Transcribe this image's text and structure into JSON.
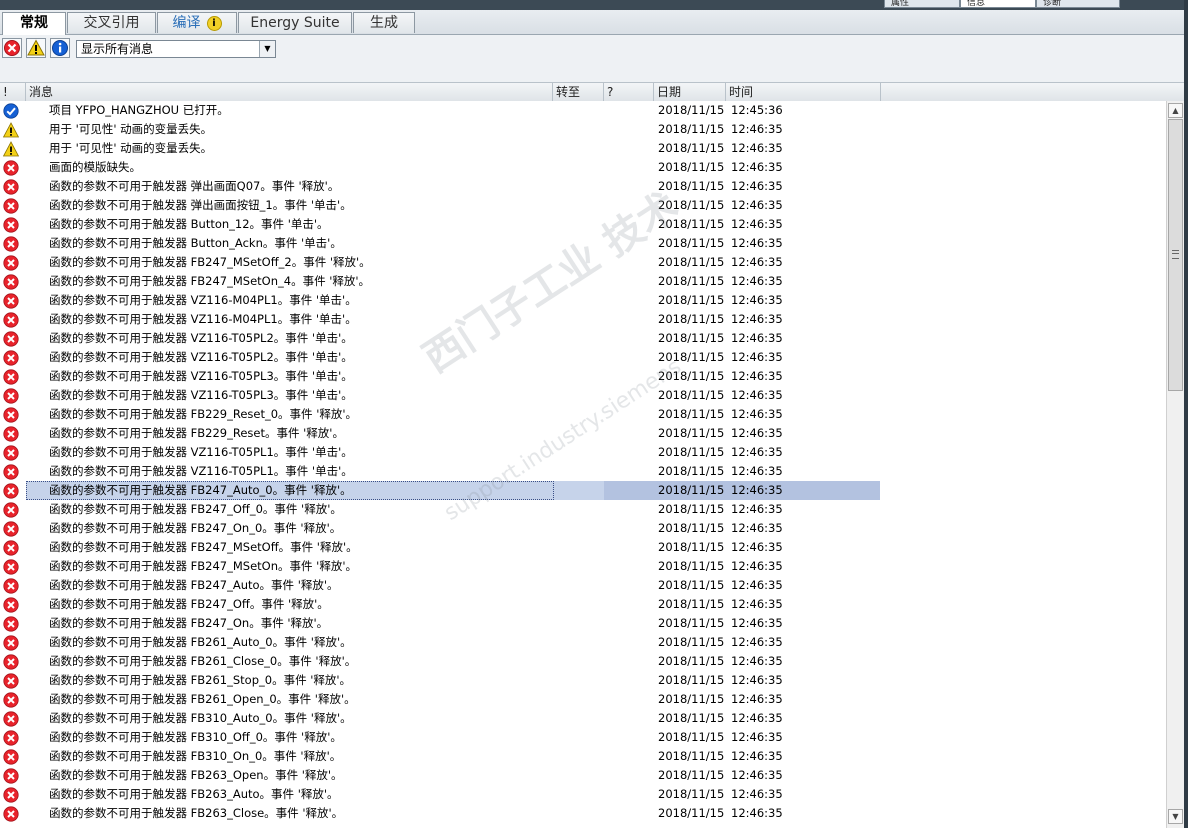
{
  "top_tabs": [
    {
      "label": "属性"
    },
    {
      "label": "信息"
    },
    {
      "label": "诊断"
    }
  ],
  "tabs": [
    {
      "label": "常规",
      "active": true
    },
    {
      "label": "交叉引用"
    },
    {
      "label": "编译",
      "info_badge": "i"
    },
    {
      "label": "Energy Suite"
    },
    {
      "label": "生成"
    }
  ],
  "toolbar": {
    "filter_value": "显示所有消息",
    "error_filter_icon": "error-filter-icon",
    "warning_filter_icon": "warning-filter-icon",
    "info_filter_icon": "info-filter-icon"
  },
  "columns": {
    "severity": "!",
    "message": "消息",
    "goto": "转至",
    "help": "?",
    "date": "日期",
    "time": "时间"
  },
  "colors": {
    "error": "#e8232b",
    "warning": "#f3d117",
    "ok": "#1560d4",
    "selected_row": "#c6d3ea"
  },
  "watermark": {
    "line1": "西门子工业 技术",
    "line2": "support.industry.siemens"
  },
  "rows": [
    {
      "type": "ok",
      "message": "项目 YFPO_HANGZHOU 已打开。",
      "date": "2018/11/15",
      "time": "12:45:36"
    },
    {
      "type": "warning",
      "message": "用于 '可见性' 动画的变量丢失。",
      "date": "2018/11/15",
      "time": "12:46:35"
    },
    {
      "type": "warning",
      "message": "用于 '可见性' 动画的变量丢失。",
      "date": "2018/11/15",
      "time": "12:46:35"
    },
    {
      "type": "error",
      "message": "画面的模版缺失。",
      "date": "2018/11/15",
      "time": "12:46:35"
    },
    {
      "type": "error",
      "message": "函数的参数不可用于触发器 弹出画面Q07。事件 '释放'。",
      "date": "2018/11/15",
      "time": "12:46:35"
    },
    {
      "type": "error",
      "message": "函数的参数不可用于触发器 弹出画面按钮_1。事件 '单击'。",
      "date": "2018/11/15",
      "time": "12:46:35"
    },
    {
      "type": "error",
      "message": "函数的参数不可用于触发器 Button_12。事件 '单击'。",
      "date": "2018/11/15",
      "time": "12:46:35"
    },
    {
      "type": "error",
      "message": "函数的参数不可用于触发器 Button_Ackn。事件 '单击'。",
      "date": "2018/11/15",
      "time": "12:46:35"
    },
    {
      "type": "error",
      "message": "函数的参数不可用于触发器 FB247_MSetOff_2。事件 '释放'。",
      "date": "2018/11/15",
      "time": "12:46:35"
    },
    {
      "type": "error",
      "message": "函数的参数不可用于触发器 FB247_MSetOn_4。事件 '释放'。",
      "date": "2018/11/15",
      "time": "12:46:35"
    },
    {
      "type": "error",
      "message": "函数的参数不可用于触发器 VZ116-M04PL1。事件 '单击'。",
      "date": "2018/11/15",
      "time": "12:46:35"
    },
    {
      "type": "error",
      "message": "函数的参数不可用于触发器 VZ116-M04PL1。事件 '单击'。",
      "date": "2018/11/15",
      "time": "12:46:35"
    },
    {
      "type": "error",
      "message": "函数的参数不可用于触发器 VZ116-T05PL2。事件 '单击'。",
      "date": "2018/11/15",
      "time": "12:46:35"
    },
    {
      "type": "error",
      "message": "函数的参数不可用于触发器 VZ116-T05PL2。事件 '单击'。",
      "date": "2018/11/15",
      "time": "12:46:35"
    },
    {
      "type": "error",
      "message": "函数的参数不可用于触发器 VZ116-T05PL3。事件 '单击'。",
      "date": "2018/11/15",
      "time": "12:46:35"
    },
    {
      "type": "error",
      "message": "函数的参数不可用于触发器 VZ116-T05PL3。事件 '单击'。",
      "date": "2018/11/15",
      "time": "12:46:35"
    },
    {
      "type": "error",
      "message": "函数的参数不可用于触发器 FB229_Reset_0。事件 '释放'。",
      "date": "2018/11/15",
      "time": "12:46:35"
    },
    {
      "type": "error",
      "message": "函数的参数不可用于触发器 FB229_Reset。事件 '释放'。",
      "date": "2018/11/15",
      "time": "12:46:35"
    },
    {
      "type": "error",
      "message": "函数的参数不可用于触发器 VZ116-T05PL1。事件 '单击'。",
      "date": "2018/11/15",
      "time": "12:46:35"
    },
    {
      "type": "error",
      "message": "函数的参数不可用于触发器 VZ116-T05PL1。事件 '单击'。",
      "date": "2018/11/15",
      "time": "12:46:35"
    },
    {
      "type": "error",
      "message": "函数的参数不可用于触发器 FB247_Auto_0。事件 '释放'。",
      "date": "2018/11/15",
      "time": "12:46:35",
      "selected": true
    },
    {
      "type": "error",
      "message": "函数的参数不可用于触发器 FB247_Off_0。事件 '释放'。",
      "date": "2018/11/15",
      "time": "12:46:35"
    },
    {
      "type": "error",
      "message": "函数的参数不可用于触发器 FB247_On_0。事件 '释放'。",
      "date": "2018/11/15",
      "time": "12:46:35"
    },
    {
      "type": "error",
      "message": "函数的参数不可用于触发器 FB247_MSetOff。事件 '释放'。",
      "date": "2018/11/15",
      "time": "12:46:35"
    },
    {
      "type": "error",
      "message": "函数的参数不可用于触发器 FB247_MSetOn。事件 '释放'。",
      "date": "2018/11/15",
      "time": "12:46:35"
    },
    {
      "type": "error",
      "message": "函数的参数不可用于触发器 FB247_Auto。事件 '释放'。",
      "date": "2018/11/15",
      "time": "12:46:35"
    },
    {
      "type": "error",
      "message": "函数的参数不可用于触发器 FB247_Off。事件 '释放'。",
      "date": "2018/11/15",
      "time": "12:46:35"
    },
    {
      "type": "error",
      "message": "函数的参数不可用于触发器 FB247_On。事件 '释放'。",
      "date": "2018/11/15",
      "time": "12:46:35"
    },
    {
      "type": "error",
      "message": "函数的参数不可用于触发器 FB261_Auto_0。事件 '释放'。",
      "date": "2018/11/15",
      "time": "12:46:35"
    },
    {
      "type": "error",
      "message": "函数的参数不可用于触发器 FB261_Close_0。事件 '释放'。",
      "date": "2018/11/15",
      "time": "12:46:35"
    },
    {
      "type": "error",
      "message": "函数的参数不可用于触发器 FB261_Stop_0。事件 '释放'。",
      "date": "2018/11/15",
      "time": "12:46:35"
    },
    {
      "type": "error",
      "message": "函数的参数不可用于触发器 FB261_Open_0。事件 '释放'。",
      "date": "2018/11/15",
      "time": "12:46:35"
    },
    {
      "type": "error",
      "message": "函数的参数不可用于触发器 FB310_Auto_0。事件 '释放'。",
      "date": "2018/11/15",
      "time": "12:46:35"
    },
    {
      "type": "error",
      "message": "函数的参数不可用于触发器 FB310_Off_0。事件 '释放'。",
      "date": "2018/11/15",
      "time": "12:46:35"
    },
    {
      "type": "error",
      "message": "函数的参数不可用于触发器 FB310_On_0。事件 '释放'。",
      "date": "2018/11/15",
      "time": "12:46:35"
    },
    {
      "type": "error",
      "message": "函数的参数不可用于触发器 FB263_Open。事件 '释放'。",
      "date": "2018/11/15",
      "time": "12:46:35"
    },
    {
      "type": "error",
      "message": "函数的参数不可用于触发器 FB263_Auto。事件 '释放'。",
      "date": "2018/11/15",
      "time": "12:46:35"
    },
    {
      "type": "error",
      "message": "函数的参数不可用于触发器 FB263_Close。事件 '释放'。",
      "date": "2018/11/15",
      "time": "12:46:35"
    }
  ]
}
